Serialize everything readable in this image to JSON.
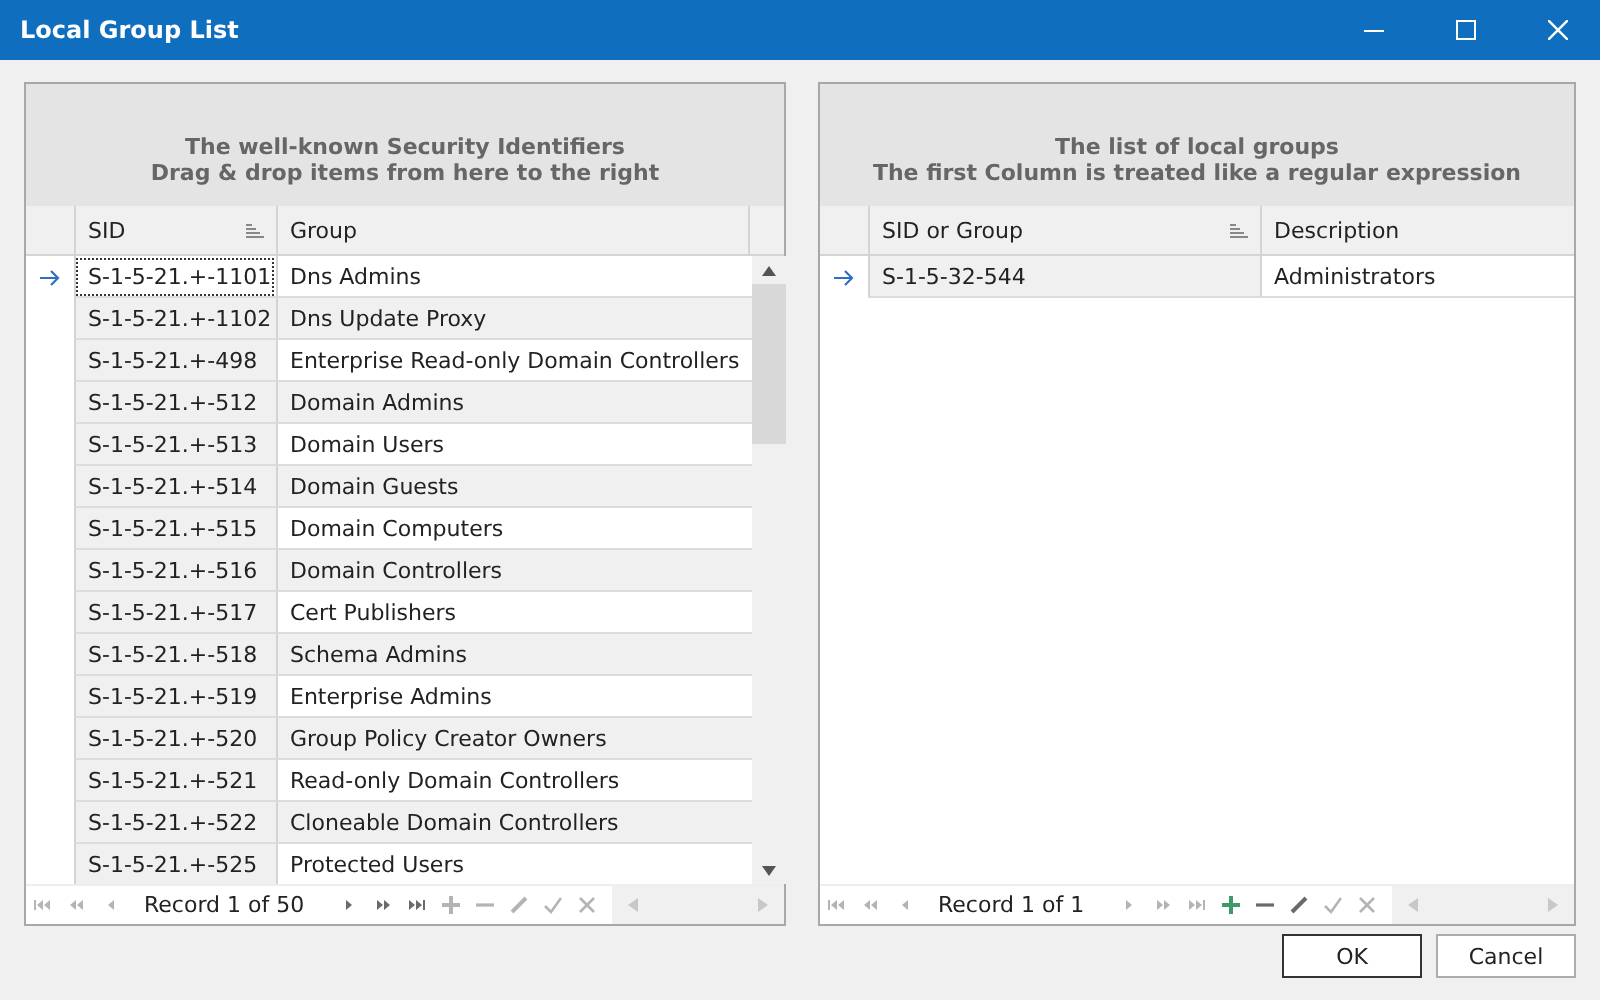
{
  "window": {
    "title": "Local Group List"
  },
  "panels": [
    {
      "caption": [
        "The well-known Security Identifiers",
        "Drag & drop items from here to the right"
      ],
      "has_focus": true,
      "scrollbar": true,
      "columns": [
        {
          "label": "SID",
          "sorted": true
        },
        {
          "label": "Group",
          "sorted": false
        }
      ],
      "rows": [
        {
          "cells": [
            "S-1-5-21.+-1101",
            "Dns Admins"
          ],
          "current": true
        },
        {
          "cells": [
            "S-1-5-21.+-1102",
            "Dns Update Proxy"
          ],
          "current": false
        },
        {
          "cells": [
            "S-1-5-21.+-498",
            "Enterprise Read-only Domain Controllers"
          ],
          "current": false
        },
        {
          "cells": [
            "S-1-5-21.+-512",
            "Domain Admins"
          ],
          "current": false
        },
        {
          "cells": [
            "S-1-5-21.+-513",
            "Domain Users"
          ],
          "current": false
        },
        {
          "cells": [
            "S-1-5-21.+-514",
            "Domain Guests"
          ],
          "current": false
        },
        {
          "cells": [
            "S-1-5-21.+-515",
            "Domain Computers"
          ],
          "current": false
        },
        {
          "cells": [
            "S-1-5-21.+-516",
            "Domain Controllers"
          ],
          "current": false
        },
        {
          "cells": [
            "S-1-5-21.+-517",
            "Cert Publishers"
          ],
          "current": false
        },
        {
          "cells": [
            "S-1-5-21.+-518",
            "Schema Admins"
          ],
          "current": false
        },
        {
          "cells": [
            "S-1-5-21.+-519",
            "Enterprise Admins"
          ],
          "current": false
        },
        {
          "cells": [
            "S-1-5-21.+-520",
            "Group Policy Creator Owners"
          ],
          "current": false
        },
        {
          "cells": [
            "S-1-5-21.+-521",
            "Read-only Domain Controllers"
          ],
          "current": false
        },
        {
          "cells": [
            "S-1-5-21.+-522",
            "Cloneable Domain Controllers"
          ],
          "current": false
        },
        {
          "cells": [
            "S-1-5-21.+-525",
            "Protected Users"
          ],
          "current": false
        }
      ],
      "navigator": {
        "record": "Record 1 of 50",
        "buttons": [
          {
            "kind": "first",
            "disabled": true
          },
          {
            "kind": "prev-page",
            "disabled": true
          },
          {
            "kind": "prev",
            "disabled": true
          },
          {
            "kind": "next",
            "disabled": false
          },
          {
            "kind": "next-page",
            "disabled": false
          },
          {
            "kind": "last",
            "disabled": false
          },
          {
            "kind": "append",
            "disabled": true
          },
          {
            "kind": "remove",
            "disabled": true
          },
          {
            "kind": "edit",
            "disabled": true
          },
          {
            "kind": "save",
            "disabled": true
          },
          {
            "kind": "cancel",
            "disabled": true
          }
        ]
      }
    },
    {
      "caption": [
        "The list of local groups",
        "The first Column is treated like a regular expression"
      ],
      "has_focus": false,
      "scrollbar": false,
      "columns": [
        {
          "label": "SID or Group",
          "sorted": true
        },
        {
          "label": "Description",
          "sorted": false
        }
      ],
      "rows": [
        {
          "cells": [
            "S-1-5-32-544",
            "Administrators"
          ],
          "current": true
        }
      ],
      "navigator": {
        "record": "Record 1 of 1",
        "buttons": [
          {
            "kind": "first",
            "disabled": true
          },
          {
            "kind": "prev-page",
            "disabled": true
          },
          {
            "kind": "prev",
            "disabled": true
          },
          {
            "kind": "next",
            "disabled": true
          },
          {
            "kind": "next-page",
            "disabled": true
          },
          {
            "kind": "last",
            "disabled": true
          },
          {
            "kind": "append",
            "disabled": false
          },
          {
            "kind": "remove",
            "disabled": false
          },
          {
            "kind": "edit",
            "disabled": false
          },
          {
            "kind": "save",
            "disabled": true
          },
          {
            "kind": "cancel",
            "disabled": true
          }
        ]
      }
    }
  ],
  "buttons": [
    {
      "label": "OK",
      "default": true
    },
    {
      "label": "Cancel",
      "default": false
    }
  ]
}
